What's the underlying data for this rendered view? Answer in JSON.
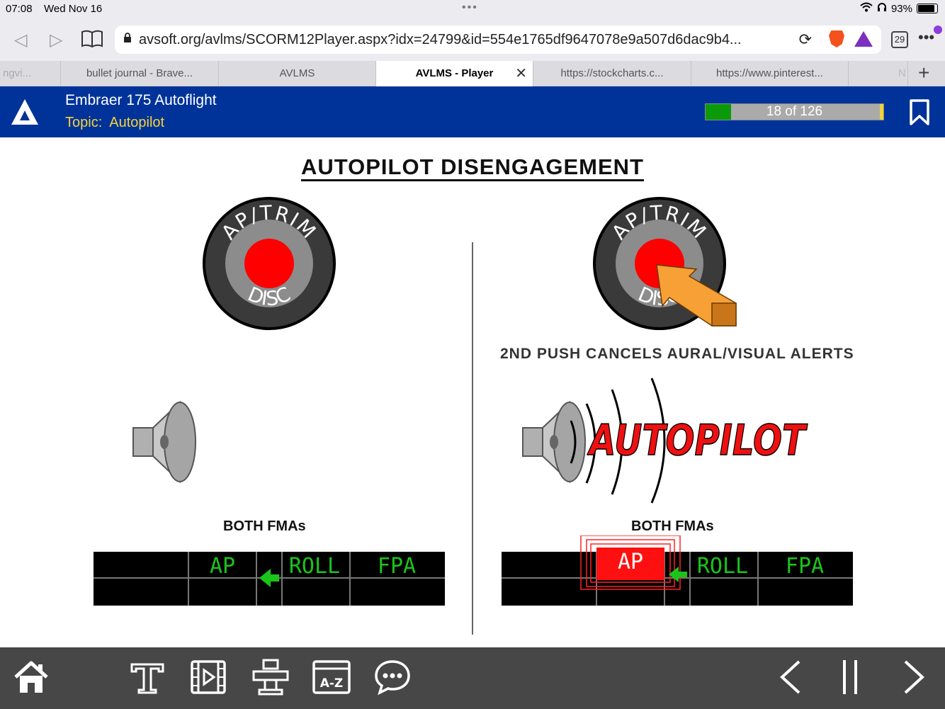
{
  "status_bar": {
    "time": "07:08",
    "date": "Wed Nov 16",
    "battery": "93%"
  },
  "browser": {
    "url": "avsoft.org/avlms/SCORM12Player.aspx?idx=24799&id=554e1765df9647078e9a507d6dac9b4...",
    "tab_count": "29",
    "tabs": [
      {
        "label": "ngvi..."
      },
      {
        "label": "bullet journal - Brave..."
      },
      {
        "label": "AVLMS"
      },
      {
        "label": "AVLMS - Player"
      },
      {
        "label": "https://stockcharts.c..."
      },
      {
        "label": "https://www.pinterest..."
      },
      {
        "label": "N"
      }
    ]
  },
  "header": {
    "course_title": "Embraer 175 Autoflight",
    "topic_label": "Topic:",
    "topic_value": "Autopilot",
    "progress_text": "18 of 126",
    "progress_fraction": 0.143,
    "colors": {
      "bar": "#003399",
      "accent": "#f5d33b",
      "progress": "#0a9a0a"
    }
  },
  "slide": {
    "title": "AUTOPILOT DISENGAGEMENT",
    "button_top_text": "AP/TRIM",
    "button_bottom_text": "DISC",
    "right_caption": "2ND PUSH CANCELS AURAL/VISUAL ALERTS",
    "aural_word": "AUTOPILOT",
    "fma_label": "BOTH FMAs",
    "fma_cells": {
      "ap": "AP",
      "roll": "ROLL",
      "fpa": "FPA"
    }
  },
  "footer": {
    "icons": [
      "home-icon",
      "text-icon",
      "video-icon",
      "presenter-icon",
      "glossary-icon",
      "chat-icon",
      "previous-icon",
      "pause-icon",
      "next-icon"
    ],
    "glossary_text": "A-Z"
  }
}
